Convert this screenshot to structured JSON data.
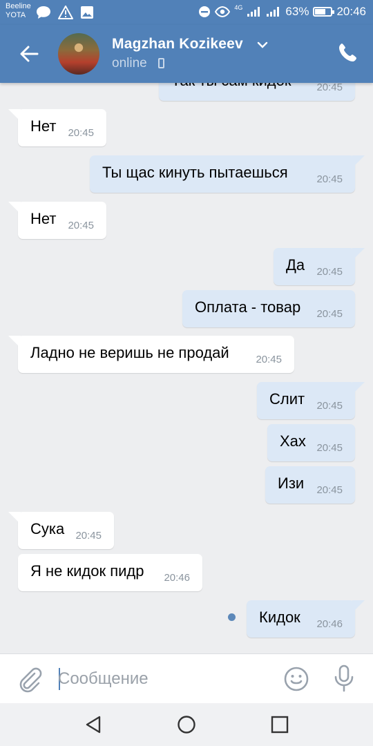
{
  "status_bar": {
    "carrier_line1": "Beeline",
    "carrier_line2": "YOTA",
    "network": "4G",
    "battery": "63%",
    "time": "20:46"
  },
  "header": {
    "contact_name": "Magzhan Kozikeev",
    "status": "online",
    "icons": [
      "back-arrow-icon",
      "chevron-down-icon",
      "mobile-device-icon",
      "phone-icon"
    ]
  },
  "messages": [
    {
      "dir": "out",
      "text": "Так ты сам кидок",
      "time": "20:45"
    },
    {
      "dir": "in",
      "text": "Нет",
      "time": "20:45"
    },
    {
      "dir": "out",
      "text": "Ты щас кинуть пытаешься",
      "time": "20:45"
    },
    {
      "dir": "in",
      "text": "Нет",
      "time": "20:45"
    },
    {
      "dir": "out",
      "text": "Да",
      "time": "20:45"
    },
    {
      "dir": "out",
      "text": "Оплата - товар",
      "time": "20:45"
    },
    {
      "dir": "in",
      "text": "Ладно не веришь не продай",
      "time": "20:45"
    },
    {
      "dir": "out",
      "text": "Слит",
      "time": "20:45"
    },
    {
      "dir": "out",
      "text": "Хах",
      "time": "20:45"
    },
    {
      "dir": "out",
      "text": "Изи",
      "time": "20:45"
    },
    {
      "dir": "in",
      "text": "Сука",
      "time": "20:45"
    },
    {
      "dir": "in",
      "text": "Я не кидок пидр",
      "time": "20:46"
    },
    {
      "dir": "out",
      "text": "Кидок",
      "time": "20:46",
      "unread": true
    }
  ],
  "composer": {
    "placeholder": "Сообщение",
    "value": ""
  },
  "colors": {
    "header_bg": "#5181b8",
    "chat_bg": "#edeef0",
    "incoming_bubble": "#ffffff",
    "outgoing_bubble": "#dce8f6"
  }
}
